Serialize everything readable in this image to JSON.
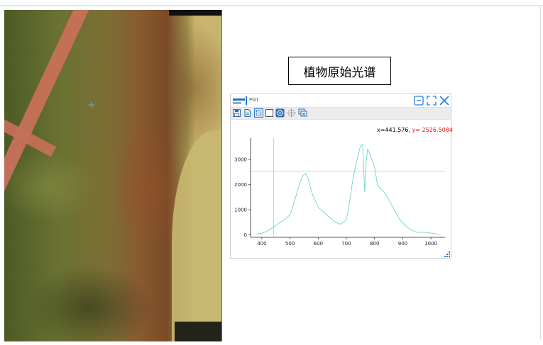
{
  "title_box": {
    "text": "植物原始光谱"
  },
  "plot_window": {
    "logo": "Open\nSpectra",
    "title": "Plot",
    "coord_readout": {
      "x_text": "x=441.576,",
      "y_text": "y= 2526.5084"
    },
    "toolbar": [
      "save-icon",
      "document-icon",
      "zoom-select-icon",
      "rectangle-select-icon",
      "target-icon",
      "pan-icon",
      "reset-view-icon"
    ]
  },
  "colors": {
    "accent": "#2a7de1",
    "spectrum": "#6fd3c8",
    "crosshair": "#c8cf86",
    "readout_y": "#e01010"
  },
  "chart_data": {
    "type": "line",
    "title": "",
    "xlabel": "",
    "ylabel": "",
    "xlim": [
      360,
      1050
    ],
    "ylim": [
      -100,
      3850
    ],
    "xticks": [
      400,
      500,
      600,
      700,
      800,
      900,
      1000
    ],
    "yticks": [
      0,
      1000,
      2000,
      3000
    ],
    "grid": false,
    "crosshair": {
      "x": 441.576,
      "y": 2526.5084
    },
    "series": [
      {
        "name": "",
        "x": [
          380,
          400,
          420,
          440,
          460,
          480,
          500,
          515,
          530,
          545,
          555,
          565,
          580,
          600,
          620,
          640,
          660,
          680,
          700,
          710,
          720,
          730,
          740,
          750,
          758,
          765,
          770,
          775,
          780,
          790,
          800,
          810,
          820,
          830,
          840,
          850,
          870,
          890,
          910,
          930,
          950,
          980,
          1010,
          1030
        ],
        "y": [
          30,
          60,
          150,
          300,
          450,
          600,
          800,
          1300,
          1900,
          2350,
          2450,
          2200,
          1600,
          1100,
          900,
          700,
          500,
          420,
          600,
          1200,
          2000,
          2600,
          3100,
          3550,
          3600,
          1700,
          2900,
          3400,
          3300,
          3000,
          2700,
          2000,
          1850,
          1750,
          1600,
          1400,
          1000,
          600,
          350,
          200,
          100,
          100,
          50,
          20
        ]
      }
    ]
  }
}
